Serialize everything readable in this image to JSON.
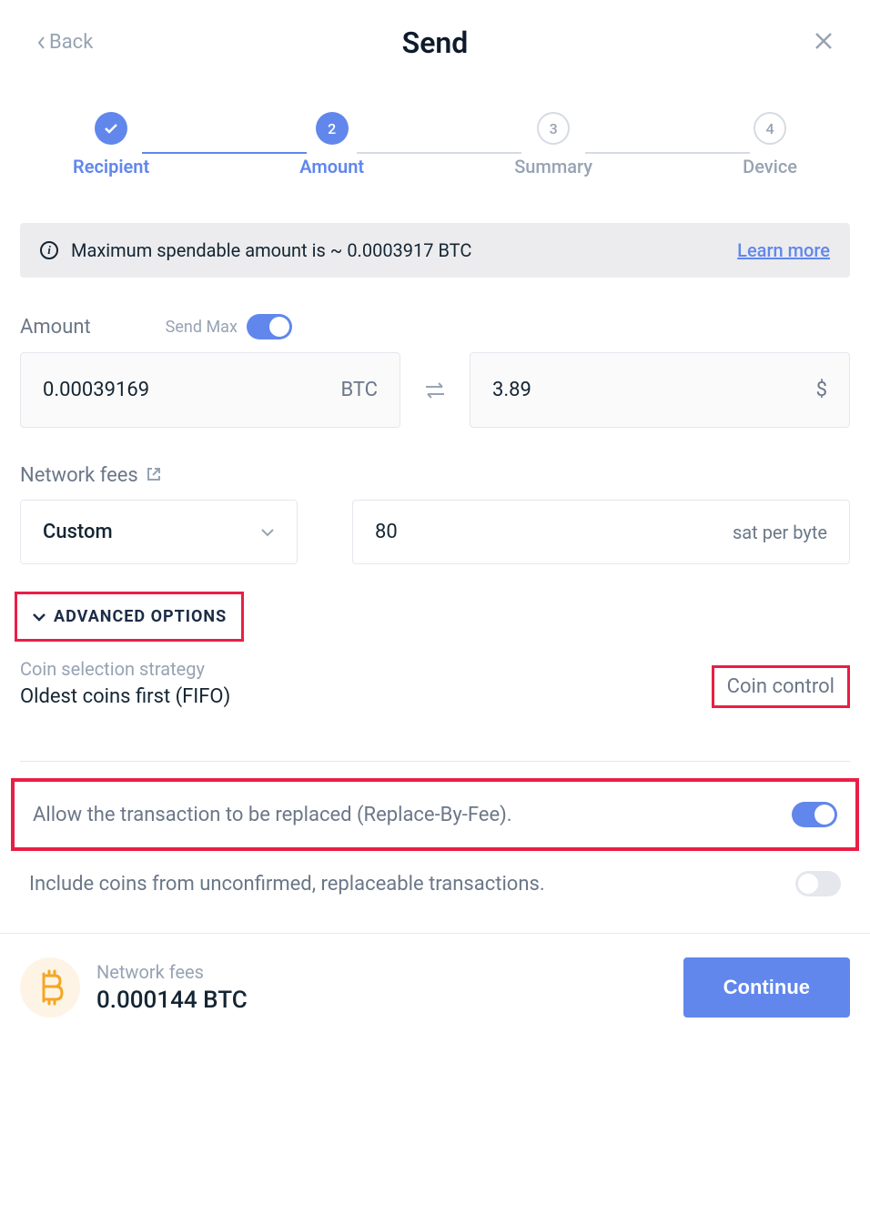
{
  "header": {
    "back_label": "Back",
    "title": "Send"
  },
  "stepper": {
    "steps": [
      {
        "label": "Recipient",
        "state": "done"
      },
      {
        "label": "Amount",
        "state": "active",
        "num": "2"
      },
      {
        "label": "Summary",
        "state": "inactive",
        "num": "3"
      },
      {
        "label": "Device",
        "state": "inactive",
        "num": "4"
      }
    ]
  },
  "info": {
    "text": "Maximum spendable amount is ~ 0.0003917 BTC",
    "learn_more": "Learn more"
  },
  "amount": {
    "label": "Amount",
    "send_max_label": "Send Max",
    "crypto_value": "0.00039169",
    "crypto_unit": "BTC",
    "fiat_value": "3.89",
    "fiat_unit": "$"
  },
  "network_fees": {
    "label": "Network fees",
    "select_value": "Custom",
    "fee_value": "80",
    "fee_unit": "sat per byte"
  },
  "advanced": {
    "label": "ADVANCED OPTIONS"
  },
  "coin_selection": {
    "label": "Coin selection strategy",
    "value": "Oldest coins first (FIFO)",
    "button": "Coin control"
  },
  "options": {
    "rbf_label": "Allow the transaction to be replaced (Replace-By-Fee).",
    "unconfirmed_label": "Include coins from unconfirmed, replaceable transactions."
  },
  "footer": {
    "fee_label": "Network fees",
    "fee_value": "0.000144 BTC",
    "continue_label": "Continue"
  }
}
